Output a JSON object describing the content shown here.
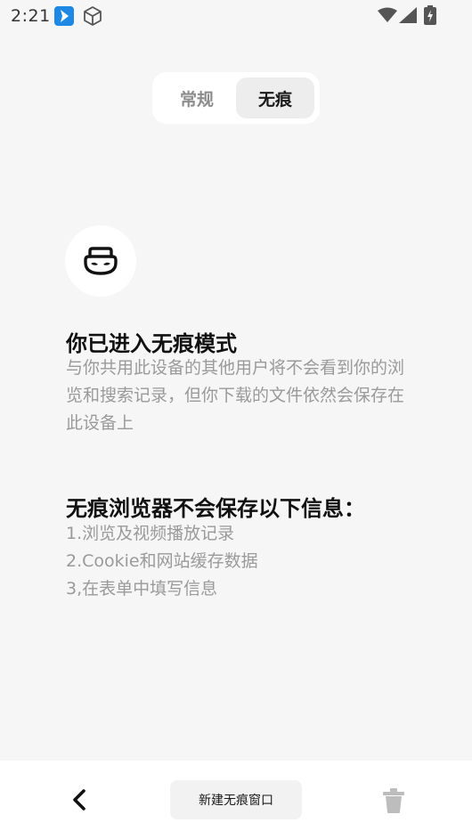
{
  "status_bar": {
    "time": "2:21",
    "icons": [
      "app-notification-icon",
      "box-icon",
      "wifi-icon",
      "cell-signal-icon",
      "battery-icon"
    ]
  },
  "tabs": {
    "regular": "常规",
    "incognito": "无痕",
    "active": "无痕"
  },
  "intro": {
    "icon": "mask-icon",
    "title": "你已进入无痕模式",
    "body": "与你共用此设备的其他用户将不会看到你的浏览和搜索记录，但你下载的文件依然会保存在此设备上"
  },
  "not_saved": {
    "title": "无痕浏览器不会保存以下信息：",
    "items": [
      "1.浏览及视频播放记录",
      "2.Cookie和网站缓存数据",
      "3,在表单中填写信息"
    ]
  },
  "bottom_bar": {
    "back_icon": "chevron-left-icon",
    "new_window_label": "新建无痕窗口",
    "trash_icon": "trash-icon"
  },
  "colors": {
    "background": "#f6f6f6",
    "text_primary": "#111111",
    "text_secondary": "#9a9a9a",
    "app_icon_blue": "#1e88e5"
  }
}
